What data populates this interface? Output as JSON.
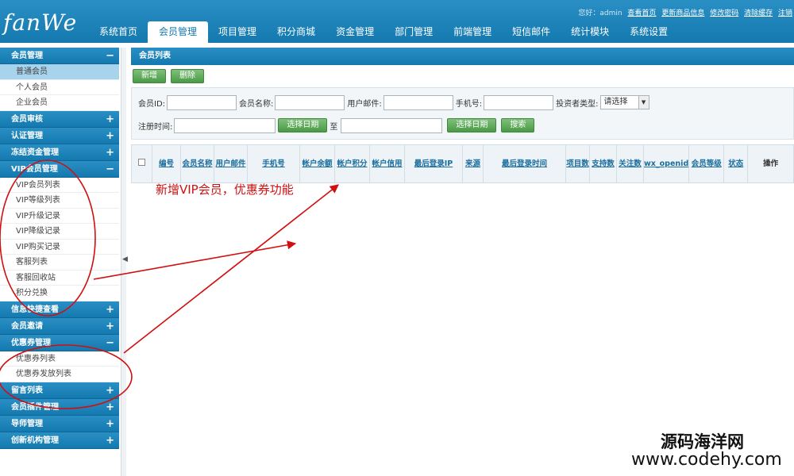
{
  "app": {
    "logo": "fanWe"
  },
  "header": {
    "welcome": "您好：admin",
    "links": [
      "查看首页",
      "更新商品信息",
      "修改密码",
      "清除缓存",
      "注销"
    ],
    "tabs": [
      "系统首页",
      "会员管理",
      "项目管理",
      "积分商城",
      "资金管理",
      "部门管理",
      "前端管理",
      "短信邮件",
      "统计模块",
      "系统设置"
    ],
    "active_tab": "会员管理"
  },
  "sidebar": {
    "sections": [
      {
        "label": "会员管理",
        "toggle": "−",
        "items": [
          "普通会员",
          "个人会员",
          "企业会员"
        ]
      },
      {
        "label": "会员审核",
        "toggle": "+"
      },
      {
        "label": "认证管理",
        "toggle": "+"
      },
      {
        "label": "冻结资金管理",
        "toggle": "+"
      },
      {
        "label": "VIP会员管理",
        "toggle": "−",
        "items": [
          "VIP会员列表",
          "VIP等级列表",
          "VIP升级记录",
          "VIP降级记录",
          "VIP购买记录",
          "客服列表",
          "客服回收站",
          "积分兑换"
        ]
      },
      {
        "label": "信息快捷查看",
        "toggle": "+"
      },
      {
        "label": "会员邀请",
        "toggle": "+"
      },
      {
        "label": "优惠券管理",
        "toggle": "−",
        "items": [
          "优惠券列表",
          "优惠券发放列表"
        ]
      },
      {
        "label": "留言列表",
        "toggle": "+"
      },
      {
        "label": "会员插件管理",
        "toggle": "+"
      },
      {
        "label": "导师管理",
        "toggle": "+"
      },
      {
        "label": "创新机构管理",
        "toggle": "+"
      }
    ]
  },
  "main": {
    "title": "会员列表",
    "add_label": "新增",
    "delete_label": "删除",
    "filters": {
      "id_label": "会员ID:",
      "name_label": "会员名称:",
      "email_label": "用户邮件:",
      "phone_label": "手机号:",
      "investor_label": "投资者类型:",
      "investor_value": "请选择",
      "regtime_label": "注册时间:",
      "to_label": "至",
      "pick_date_label": "选择日期",
      "search_label": "搜索"
    },
    "columns": [
      "编号",
      "会员名称",
      "用户邮件",
      "手机号",
      "帐户余额",
      "帐户积分",
      "帐户信用",
      "最后登录IP",
      "来源",
      "最后登录时间",
      "项目数",
      "支持数",
      "关注数",
      "wx_openid",
      "会员等级",
      "状态",
      "操作"
    ]
  },
  "annotation": {
    "text": "新增VIP会员，优惠券功能",
    "color": "#d10f0f"
  },
  "watermark": {
    "line1": "源码海洋网",
    "line2": "www.codehy.com"
  }
}
